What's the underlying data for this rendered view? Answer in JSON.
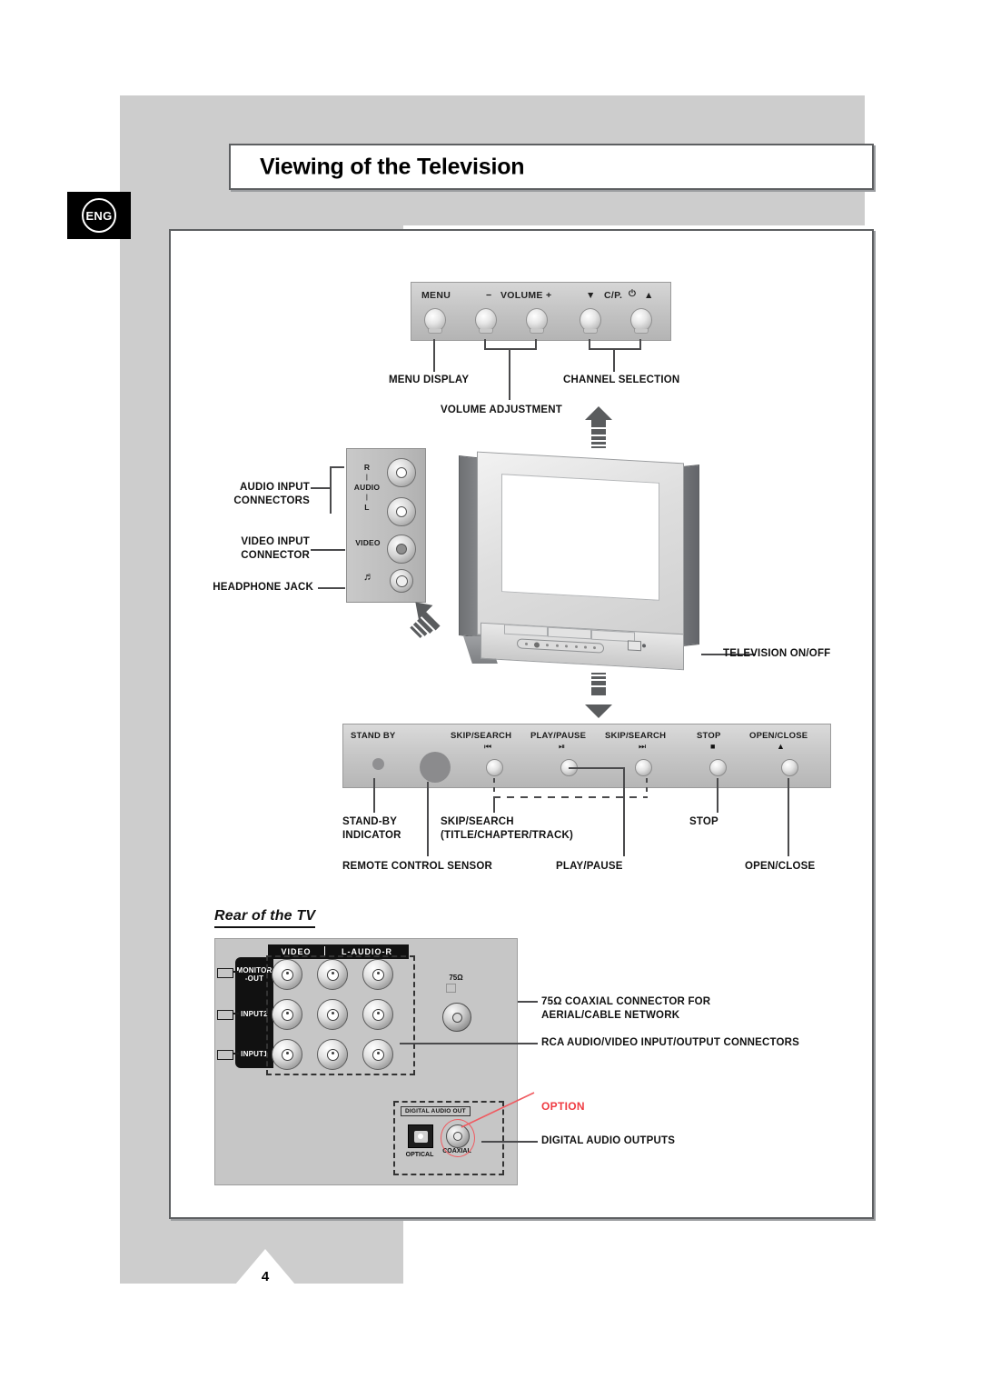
{
  "page": {
    "title": "Viewing of the Television",
    "language_badge": "ENG",
    "page_number": "4"
  },
  "top_control_panel": {
    "buttons": [
      "MENU",
      "− VOLUME +",
      "▼ C/P. ⏻ ▲"
    ],
    "menu_label": "MENU",
    "volume_label": "VOLUME",
    "volume_minus": "−",
    "volume_plus": "+",
    "channel_down": "▼",
    "channel_label": "C/P.",
    "power_glyph": "⏻",
    "channel_up": "▲",
    "callouts": {
      "menu_display": "MENU DISPLAY",
      "channel_selection": "CHANNEL SELECTION",
      "volume_adjustment": "VOLUME ADJUSTMENT"
    }
  },
  "av_input_panel": {
    "callouts": {
      "audio_input_connectors_line1": "AUDIO INPUT",
      "audio_input_connectors_line2": "CONNECTORS",
      "video_input_connector_line1": "VIDEO INPUT",
      "video_input_connector_line2": "CONNECTOR",
      "headphone_jack": "HEADPHONE JACK"
    },
    "jack_labels": {
      "right": "R",
      "audio": "AUDIO",
      "left": "L",
      "video": "VIDEO",
      "headphone_icon": "headphone-icon"
    }
  },
  "television": {
    "power_callout": "TELEVISION ON/OFF"
  },
  "dvd_control_panel": {
    "top_labels": [
      {
        "text": "STAND BY",
        "icon": ""
      },
      {
        "text": "SKIP/SEARCH",
        "icon": "◄◄"
      },
      {
        "text": "PLAY/PAUSE",
        "icon": "►II"
      },
      {
        "text": "SKIP/SEARCH",
        "icon": "►►"
      },
      {
        "text": "STOP",
        "icon": "■"
      },
      {
        "text": "OPEN/CLOSE",
        "icon": "▲"
      }
    ],
    "callouts": {
      "standby_indicator_line1": "STAND-BY",
      "standby_indicator_line2": "INDICATOR",
      "skip_search_line1": "SKIP/SEARCH",
      "skip_search_line2": "(TITLE/CHAPTER/TRACK)",
      "stop": "STOP",
      "remote_control_sensor": "REMOTE CONTROL SENSOR",
      "play_pause": "PLAY/PAUSE",
      "open_close": "OPEN/CLOSE"
    }
  },
  "rear_of_tv": {
    "section_title": "Rear of the TV",
    "rca_header_video": "VIDEO",
    "rca_header_audio": "L-AUDIO-R",
    "row_labels": [
      {
        "line1": "MONITOR",
        "line2": "-OUT"
      },
      {
        "line1": "INPUT2",
        "line2": ""
      },
      {
        "line1": "INPUT1",
        "line2": ""
      }
    ],
    "coaxial_label": "75Ω",
    "digital_audio_out_tag": "DIGITAL AUDIO OUT",
    "optical_label": "OPTICAL",
    "coaxial_jack_label": "COAXIAL",
    "option_label": "OPTION",
    "callouts": {
      "coaxial_line1": "75Ω COAXIAL CONNECTOR FOR",
      "coaxial_line2": "AERIAL/CABLE NETWORK",
      "rca_connectors": "RCA AUDIO/VIDEO INPUT/OUTPUT CONNECTORS",
      "digital_audio_outputs": "DIGITAL AUDIO OUTPUTS"
    }
  },
  "colors": {
    "page_gray": "#cdcdcd",
    "frame_border": "#5d5f61",
    "option_red": "#ef3b42",
    "leader_line": "#4a4a4c"
  }
}
